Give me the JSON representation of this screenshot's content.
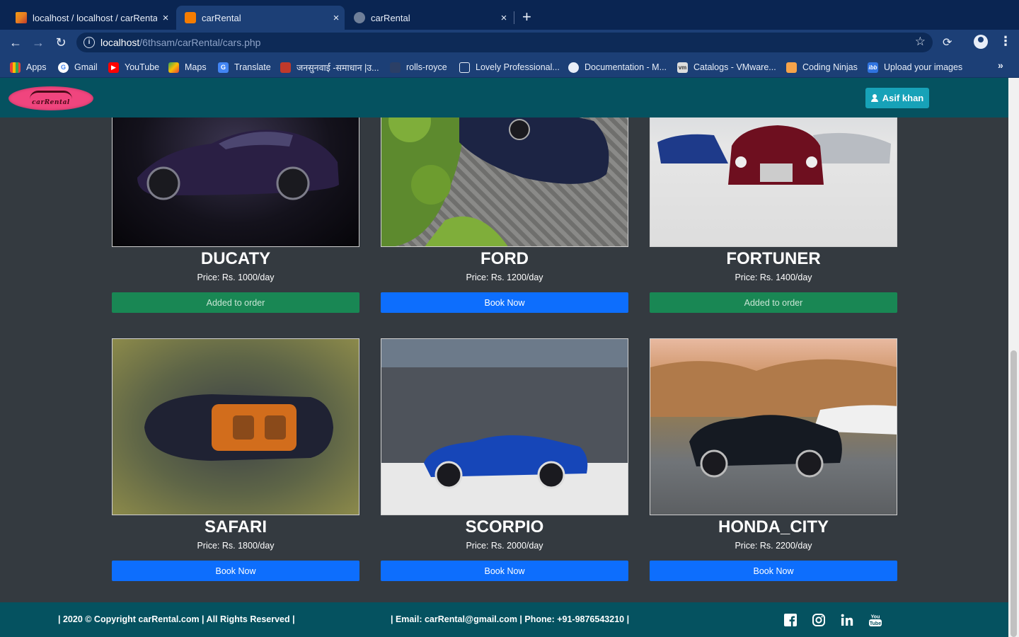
{
  "browser": {
    "tabs": [
      {
        "title": "localhost / localhost / carRental / ",
        "close": "×"
      },
      {
        "title": "carRental",
        "close": "×"
      },
      {
        "title": "carRental",
        "close": "×"
      }
    ],
    "new_tab": "+",
    "url_host": "localhost",
    "url_path": "/6thsam/carRental/cars.php",
    "bookmarks": [
      {
        "label": "Apps",
        "icon": "apps-grid-icon"
      },
      {
        "label": "Gmail",
        "icon": "google-icon"
      },
      {
        "label": "YouTube",
        "icon": "youtube-icon"
      },
      {
        "label": "Maps",
        "icon": "maps-icon"
      },
      {
        "label": "Translate",
        "icon": "translate-icon"
      },
      {
        "label": "जनसुनवाई -समाधान |उ...",
        "icon": "emblem-icon"
      },
      {
        "label": "rolls-royce",
        "icon": "rolls-royce-icon"
      },
      {
        "label": "Lovely Professional...",
        "icon": "external-link-icon"
      },
      {
        "label": "Documentation - M...",
        "icon": "compass-icon"
      },
      {
        "label": "Catalogs - VMware...",
        "icon": "vmware-icon"
      },
      {
        "label": "Coding Ninjas",
        "icon": "coding-ninjas-icon"
      },
      {
        "label": "Upload your images",
        "icon": "ibb-icon"
      }
    ],
    "bookmarks_overflow": "»"
  },
  "header": {
    "logo_text": "carRental",
    "user_label": "Asif khan"
  },
  "cars": [
    {
      "name": "DUCATY",
      "price": "Price: Rs. 1000/day",
      "button": "Added to order",
      "status": "added"
    },
    {
      "name": "FORD",
      "price": "Price: Rs. 1200/day",
      "button": "Book Now",
      "status": "book"
    },
    {
      "name": "FORTUNER",
      "price": "Price: Rs. 1400/day",
      "button": "Added to order",
      "status": "added"
    },
    {
      "name": "SAFARI",
      "price": "Price: Rs. 1800/day",
      "button": "Book Now",
      "status": "book"
    },
    {
      "name": "SCORPIO",
      "price": "Price: Rs. 2000/day",
      "button": "Book Now",
      "status": "book"
    },
    {
      "name": "HONDA_CITY",
      "price": "Price: Rs. 2200/day",
      "button": "Book Now",
      "status": "book"
    }
  ],
  "footer": {
    "copyright": "| 2020 © Copyright carRental.com | All Rights Reserved |",
    "contact": "| Email: carRental@gmail.com | Phone: +91-9876543210 |",
    "social": [
      "facebook-icon",
      "instagram-icon",
      "linkedin-icon",
      "youtube-icon"
    ]
  },
  "colors": {
    "page_bg": "#343a40",
    "header_bg": "#055260",
    "book_button": "#0d6efd",
    "added_button": "#198754",
    "user_button": "#17a2b8"
  }
}
